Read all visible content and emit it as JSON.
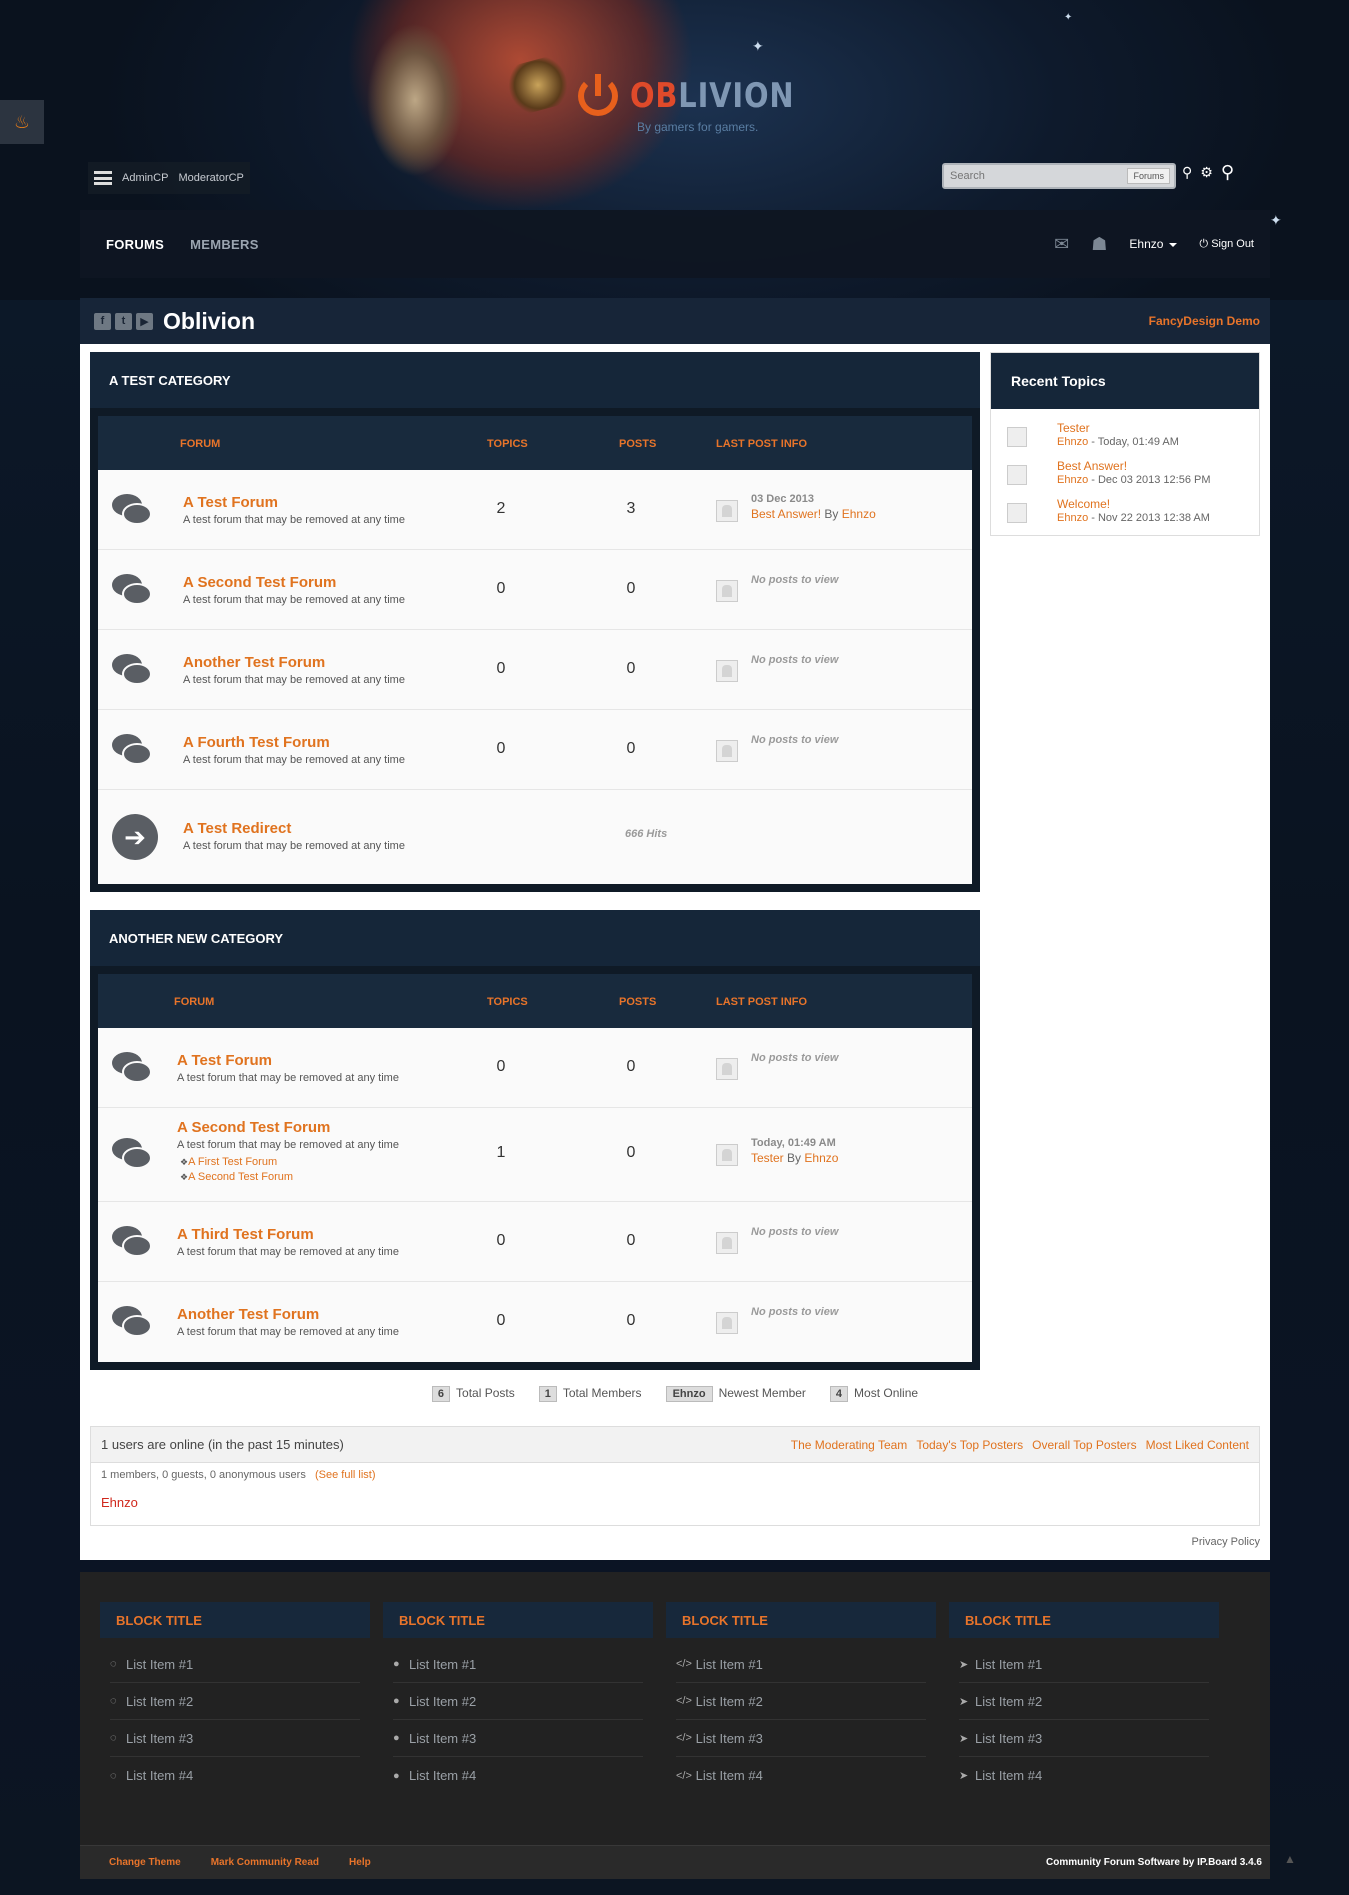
{
  "logo": {
    "text_a": "OB",
    "text_b": "LIVION",
    "tagline": "By gamers for gamers."
  },
  "admin_links": [
    "AdminCP",
    "ModeratorCP"
  ],
  "search": {
    "placeholder": "Search",
    "scope": "Forums"
  },
  "nav": {
    "tabs": [
      {
        "label": "FORUMS",
        "active": true
      },
      {
        "label": "MEMBERS",
        "active": false
      }
    ],
    "user": "Ehnzo",
    "sign_out": "Sign Out"
  },
  "page": {
    "title": "Oblivion",
    "demo_link": "FancyDesign Demo"
  },
  "columns": {
    "forum": "FORUM",
    "topics": "TOPICS",
    "posts": "POSTS",
    "last": "LAST POST INFO"
  },
  "categories": [
    {
      "title": "A TEST CATEGORY",
      "forums": [
        {
          "name": "A Test Forum",
          "desc": "A test forum that may be removed at any time",
          "topics": "2",
          "posts": "3",
          "last_date": "03 Dec 2013",
          "last_topic": "Best Answer!",
          "last_by": "By",
          "last_user": "Ehnzo"
        },
        {
          "name": "A Second Test Forum",
          "desc": "A test forum that may be removed at any time",
          "topics": "0",
          "posts": "0",
          "no_posts": "No posts to view"
        },
        {
          "name": "Another Test Forum",
          "desc": "A test forum that may be removed at any time",
          "topics": "0",
          "posts": "0",
          "no_posts": "No posts to view"
        },
        {
          "name": "A Fourth Test Forum",
          "desc": "A test forum that may be removed at any time",
          "topics": "0",
          "posts": "0",
          "no_posts": "No posts to view"
        },
        {
          "name": "A Test Redirect",
          "desc": "A test forum that may be removed at any time",
          "hits": "666 Hits"
        }
      ]
    },
    {
      "title": "ANOTHER NEW CATEGORY",
      "forums": [
        {
          "name": "A Test Forum",
          "desc": "A test forum that may be removed at any time",
          "topics": "0",
          "posts": "0",
          "no_posts": "No posts to view"
        },
        {
          "name": "A Second Test Forum",
          "desc": "A test forum that may be removed at any time",
          "topics": "1",
          "posts": "0",
          "subforums": [
            "A First Test Forum",
            "A Second Test Forum"
          ],
          "last_date": "Today, 01:49 AM",
          "last_topic": "Tester",
          "last_by": "By",
          "last_user": "Ehnzo"
        },
        {
          "name": "A Third Test Forum",
          "desc": "A test forum that may be removed at any time",
          "topics": "0",
          "posts": "0",
          "no_posts": "No posts to view"
        },
        {
          "name": "Another Test Forum",
          "desc": "A test forum that may be removed at any time",
          "topics": "0",
          "posts": "0",
          "no_posts": "No posts to view"
        }
      ]
    }
  ],
  "recent_topics": {
    "title": "Recent Topics",
    "items": [
      {
        "title": "Tester",
        "user": "Ehnzo",
        "meta": " - Today, 01:49 AM"
      },
      {
        "title": "Best Answer!",
        "user": "Ehnzo",
        "meta": " - Dec 03 2013 12:56 PM"
      },
      {
        "title": "Welcome!",
        "user": "Ehnzo",
        "meta": " - Nov 22 2013 12:38 AM"
      }
    ]
  },
  "stats": [
    {
      "value": "6",
      "label": "Total Posts"
    },
    {
      "value": "1",
      "label": "Total Members"
    },
    {
      "value": "Ehnzo",
      "label": "Newest Member"
    },
    {
      "value": "4",
      "label": "Most Online"
    }
  ],
  "online": {
    "header": "1 users are online (in the past 15 minutes)",
    "links": [
      "The Moderating Team",
      "Today's Top Posters",
      "Overall Top Posters",
      "Most Liked Content"
    ],
    "sub": "1 members, 0 guests, 0 anonymous users",
    "see_full": "(See full list)",
    "user": "Ehnzo"
  },
  "privacy": "Privacy Policy",
  "footer_blocks": [
    {
      "title": "BLOCK TITLE",
      "icon": "comment-outline-icon",
      "items": [
        "List Item #1",
        "List Item #2",
        "List Item #3",
        "List Item #4"
      ]
    },
    {
      "title": "BLOCK TITLE",
      "icon": "comment-icon",
      "items": [
        "List Item #1",
        "List Item #2",
        "List Item #3",
        "List Item #4"
      ]
    },
    {
      "title": "BLOCK TITLE",
      "icon": "code-icon",
      "items": [
        "List Item #1",
        "List Item #2",
        "List Item #3",
        "List Item #4"
      ]
    },
    {
      "title": "BLOCK TITLE",
      "icon": "location-arrow-icon",
      "items": [
        "List Item #1",
        "List Item #2",
        "List Item #3",
        "List Item #4"
      ]
    }
  ],
  "bottom_links": [
    "Change Theme",
    "Mark Community Read",
    "Help"
  ],
  "credit": "Community Forum Software by IP.Board 3.4.6",
  "colors": {
    "accent": "#e0731f",
    "header_bg": "#152639",
    "online_user": "#d0281c"
  }
}
